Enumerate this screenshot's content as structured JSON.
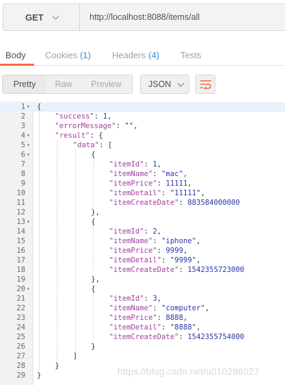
{
  "request": {
    "method": "GET",
    "url": "http://localhost:8088/items/all"
  },
  "tabs": [
    {
      "label": "Body",
      "count": ""
    },
    {
      "label": "Cookies",
      "count": "(1)"
    },
    {
      "label": "Headers",
      "count": "(4)"
    },
    {
      "label": "Tests",
      "count": ""
    }
  ],
  "response_toolbar": {
    "views": [
      "Pretty",
      "Raw",
      "Preview"
    ],
    "format": "JSON"
  },
  "colors": {
    "accent": "#f26b3a",
    "count": "#2f8fdd",
    "json_key": "#a33ea0",
    "json_value": "#2a36a8"
  },
  "code": {
    "lines": [
      {
        "n": "1",
        "fold": true,
        "indent": 0,
        "parts": [
          [
            "p",
            "{"
          ]
        ]
      },
      {
        "n": "2",
        "fold": false,
        "indent": 1,
        "parts": [
          [
            "k",
            "\"success\""
          ],
          [
            "p",
            ": "
          ],
          [
            "n",
            "1"
          ],
          [
            "p",
            ","
          ]
        ]
      },
      {
        "n": "3",
        "fold": false,
        "indent": 1,
        "parts": [
          [
            "k",
            "\"errorMessage\""
          ],
          [
            "p",
            ": "
          ],
          [
            "s",
            "\"\""
          ],
          [
            "p",
            ","
          ]
        ]
      },
      {
        "n": "4",
        "fold": true,
        "indent": 1,
        "parts": [
          [
            "k",
            "\"result\""
          ],
          [
            "p",
            ": {"
          ]
        ]
      },
      {
        "n": "5",
        "fold": true,
        "indent": 2,
        "parts": [
          [
            "k",
            "\"data\""
          ],
          [
            "p",
            ": ["
          ]
        ]
      },
      {
        "n": "6",
        "fold": true,
        "indent": 3,
        "parts": [
          [
            "p",
            "{"
          ]
        ]
      },
      {
        "n": "7",
        "fold": false,
        "indent": 4,
        "parts": [
          [
            "k",
            "\"itemId\""
          ],
          [
            "p",
            ": "
          ],
          [
            "n",
            "1"
          ],
          [
            "p",
            ","
          ]
        ]
      },
      {
        "n": "8",
        "fold": false,
        "indent": 4,
        "parts": [
          [
            "k",
            "\"itemName\""
          ],
          [
            "p",
            ": "
          ],
          [
            "s",
            "\"mac\""
          ],
          [
            "p",
            ","
          ]
        ]
      },
      {
        "n": "9",
        "fold": false,
        "indent": 4,
        "parts": [
          [
            "k",
            "\"itemPrice\""
          ],
          [
            "p",
            ": "
          ],
          [
            "n",
            "11111"
          ],
          [
            "p",
            ","
          ]
        ]
      },
      {
        "n": "10",
        "fold": false,
        "indent": 4,
        "parts": [
          [
            "k",
            "\"itemDetail\""
          ],
          [
            "p",
            ": "
          ],
          [
            "s",
            "\"11111\""
          ],
          [
            "p",
            ","
          ]
        ]
      },
      {
        "n": "11",
        "fold": false,
        "indent": 4,
        "parts": [
          [
            "k",
            "\"itemCreateDate\""
          ],
          [
            "p",
            ": "
          ],
          [
            "n",
            "883584000000"
          ]
        ]
      },
      {
        "n": "12",
        "fold": false,
        "indent": 3,
        "parts": [
          [
            "p",
            "},"
          ]
        ]
      },
      {
        "n": "13",
        "fold": true,
        "indent": 3,
        "parts": [
          [
            "p",
            "{"
          ]
        ]
      },
      {
        "n": "14",
        "fold": false,
        "indent": 4,
        "parts": [
          [
            "k",
            "\"itemId\""
          ],
          [
            "p",
            ": "
          ],
          [
            "n",
            "2"
          ],
          [
            "p",
            ","
          ]
        ]
      },
      {
        "n": "15",
        "fold": false,
        "indent": 4,
        "parts": [
          [
            "k",
            "\"itemName\""
          ],
          [
            "p",
            ": "
          ],
          [
            "s",
            "\"iphone\""
          ],
          [
            "p",
            ","
          ]
        ]
      },
      {
        "n": "16",
        "fold": false,
        "indent": 4,
        "parts": [
          [
            "k",
            "\"itemPrice\""
          ],
          [
            "p",
            ": "
          ],
          [
            "n",
            "9999"
          ],
          [
            "p",
            ","
          ]
        ]
      },
      {
        "n": "17",
        "fold": false,
        "indent": 4,
        "parts": [
          [
            "k",
            "\"itemDetail\""
          ],
          [
            "p",
            ": "
          ],
          [
            "s",
            "\"9999\""
          ],
          [
            "p",
            ","
          ]
        ]
      },
      {
        "n": "18",
        "fold": false,
        "indent": 4,
        "parts": [
          [
            "k",
            "\"itemCreateDate\""
          ],
          [
            "p",
            ": "
          ],
          [
            "n",
            "1542355723000"
          ]
        ]
      },
      {
        "n": "19",
        "fold": false,
        "indent": 3,
        "parts": [
          [
            "p",
            "},"
          ]
        ]
      },
      {
        "n": "20",
        "fold": true,
        "indent": 3,
        "parts": [
          [
            "p",
            "{"
          ]
        ]
      },
      {
        "n": "21",
        "fold": false,
        "indent": 4,
        "parts": [
          [
            "k",
            "\"itemId\""
          ],
          [
            "p",
            ": "
          ],
          [
            "n",
            "3"
          ],
          [
            "p",
            ","
          ]
        ]
      },
      {
        "n": "22",
        "fold": false,
        "indent": 4,
        "parts": [
          [
            "k",
            "\"itemName\""
          ],
          [
            "p",
            ": "
          ],
          [
            "s",
            "\"computer\""
          ],
          [
            "p",
            ","
          ]
        ]
      },
      {
        "n": "23",
        "fold": false,
        "indent": 4,
        "parts": [
          [
            "k",
            "\"itemPrice\""
          ],
          [
            "p",
            ": "
          ],
          [
            "n",
            "8888"
          ],
          [
            "p",
            ","
          ]
        ]
      },
      {
        "n": "24",
        "fold": false,
        "indent": 4,
        "parts": [
          [
            "k",
            "\"itemDetail\""
          ],
          [
            "p",
            ": "
          ],
          [
            "s",
            "\"8888\""
          ],
          [
            "p",
            ","
          ]
        ]
      },
      {
        "n": "25",
        "fold": false,
        "indent": 4,
        "parts": [
          [
            "k",
            "\"itemCreateDate\""
          ],
          [
            "p",
            ": "
          ],
          [
            "n",
            "1542355754000"
          ]
        ]
      },
      {
        "n": "26",
        "fold": false,
        "indent": 3,
        "parts": [
          [
            "p",
            "}"
          ]
        ]
      },
      {
        "n": "27",
        "fold": false,
        "indent": 2,
        "parts": [
          [
            "p",
            "]"
          ]
        ]
      },
      {
        "n": "28",
        "fold": false,
        "indent": 1,
        "parts": [
          [
            "p",
            "}"
          ]
        ]
      },
      {
        "n": "29",
        "fold": false,
        "indent": 0,
        "parts": [
          [
            "p",
            "}"
          ]
        ]
      }
    ]
  },
  "watermark": "https://blog.csdn.net/u010286027"
}
